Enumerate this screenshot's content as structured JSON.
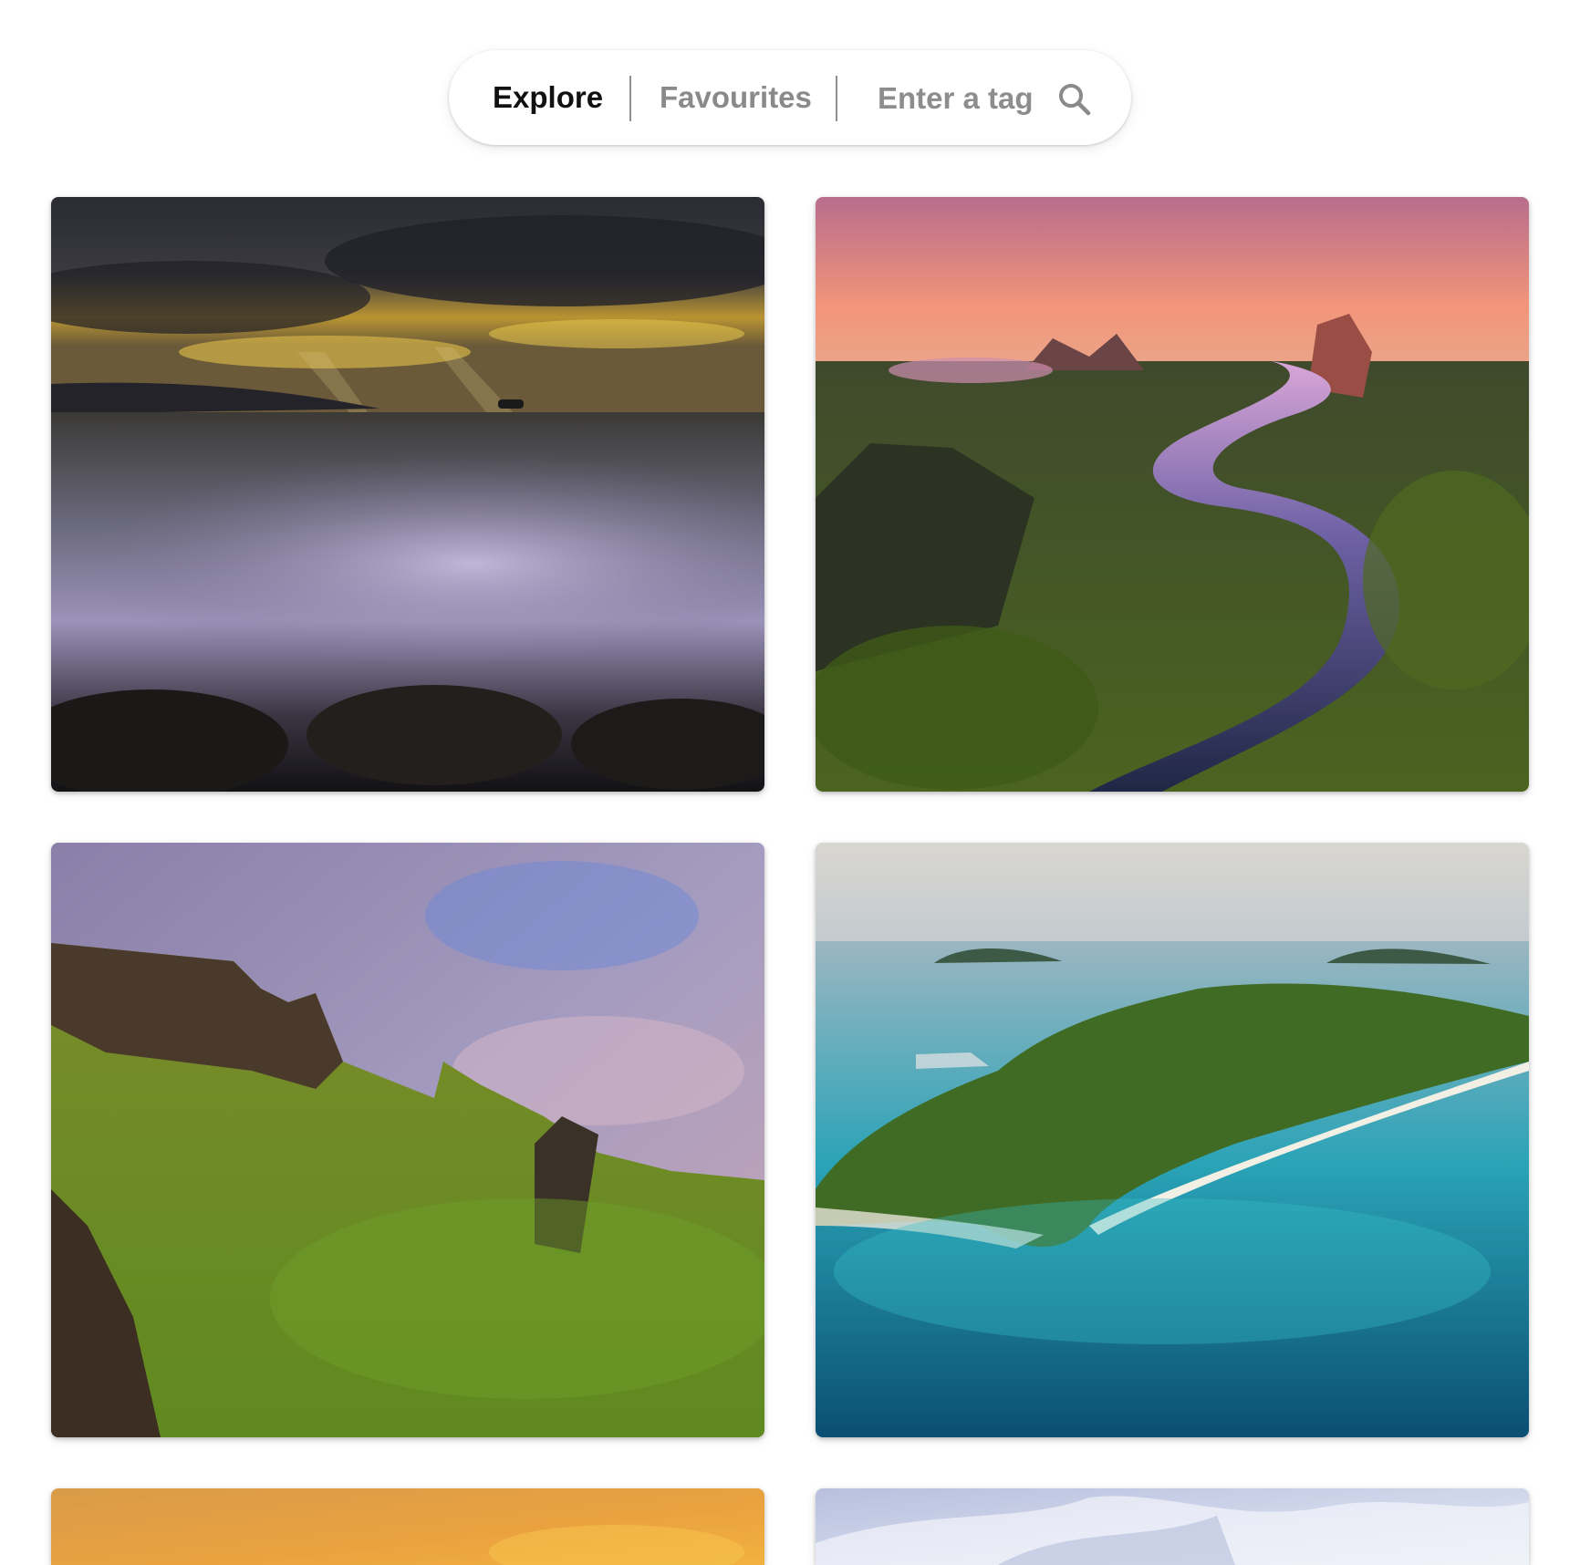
{
  "nav": {
    "explore_label": "Explore",
    "favourites_label": "Favourites",
    "active_tab": "Explore",
    "search": {
      "value": "",
      "placeholder": "Enter a tag",
      "icon": "search-icon"
    }
  },
  "gallery": {
    "columns": 2,
    "photos": [
      {
        "subject": "stormy-sea-sun-rays"
      },
      {
        "subject": "aerial-river-mangroves-sunrise"
      },
      {
        "subject": "green-cliffs-highlands"
      },
      {
        "subject": "aerial-tropical-island-coast"
      },
      {
        "subject": "golden-desert-dunes"
      },
      {
        "subject": "white-sand-dunes"
      }
    ]
  },
  "colors": {
    "active_tab": "#111111",
    "inactive_tab": "#8a8a8a",
    "placeholder": "#8d8d8d"
  }
}
